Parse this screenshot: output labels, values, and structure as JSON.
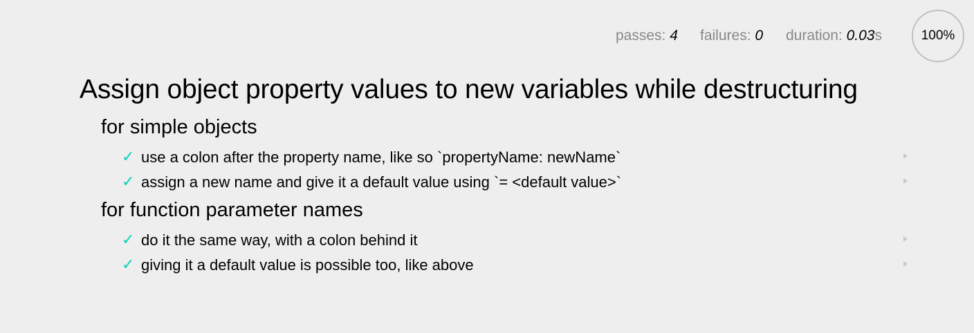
{
  "stats": {
    "passes_label": "passes: ",
    "passes_value": "4",
    "failures_label": "failures: ",
    "failures_value": "0",
    "duration_label": "duration: ",
    "duration_value": "0.03",
    "duration_unit": "s",
    "progress": "100%"
  },
  "suite": {
    "title": "Assign object property values to new variables while destructuring",
    "groups": [
      {
        "title": "for simple objects",
        "tests": [
          {
            "status_icon": "check-icon",
            "check": "✓",
            "title": "use a colon after the property name, like so `propertyName: newName`"
          },
          {
            "status_icon": "check-icon",
            "check": "✓",
            "title": "assign a new name and give it a default value using `= <default value>`"
          }
        ]
      },
      {
        "title": "for function parameter names",
        "tests": [
          {
            "status_icon": "check-icon",
            "check": "✓",
            "title": "do it the same way, with a colon behind it"
          },
          {
            "status_icon": "check-icon",
            "check": "✓",
            "title": "giving it a default value is possible too, like above"
          }
        ]
      }
    ]
  },
  "colors": {
    "pass": "#00d6b2",
    "background": "#eeeeee",
    "stat_label": "#888888"
  }
}
